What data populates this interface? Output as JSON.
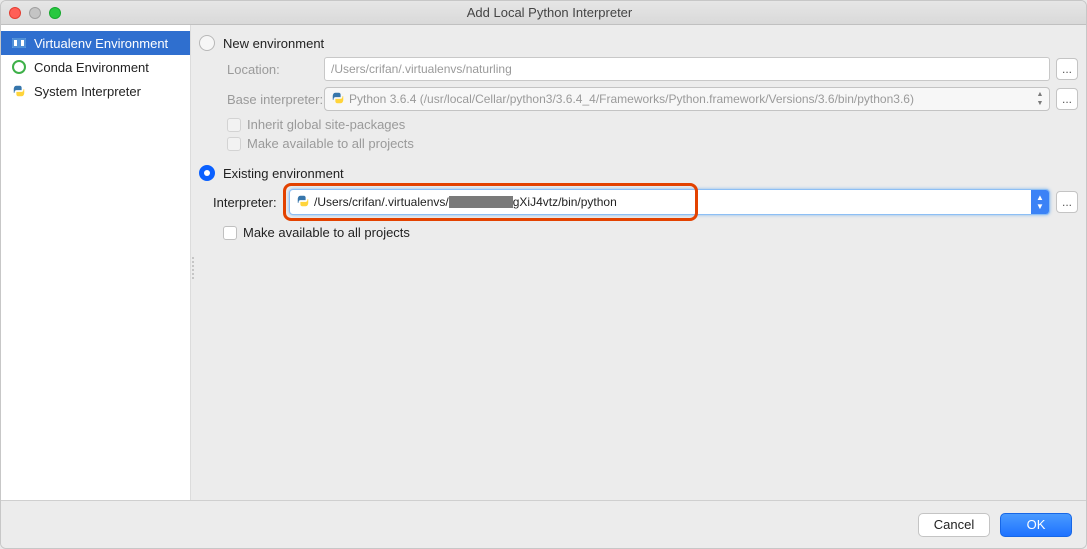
{
  "window": {
    "title": "Add Local Python Interpreter"
  },
  "sidebar": {
    "items": [
      {
        "label": "Virtualenv Environment",
        "icon": "virtualenv-icon",
        "selected": true
      },
      {
        "label": "Conda Environment",
        "icon": "conda-icon",
        "selected": false
      },
      {
        "label": "System Interpreter",
        "icon": "python-icon",
        "selected": false
      }
    ]
  },
  "new_env": {
    "radio_label": "New environment",
    "location_label": "Location:",
    "location_value": "/Users/crifan/.virtualenvs/naturling",
    "base_label": "Base interpreter:",
    "base_value": "Python 3.6.4 (/usr/local/Cellar/python3/3.6.4_4/Frameworks/Python.framework/Versions/3.6/bin/python3.6)",
    "inherit_label": "Inherit global site-packages",
    "make_available_label": "Make available to all projects"
  },
  "existing_env": {
    "radio_label": "Existing environment",
    "interpreter_label": "Interpreter:",
    "interpreter_prefix": "/Users/crifan/.virtualenvs/",
    "interpreter_suffix": "gXiJ4vtz/bin/python",
    "make_available_label": "Make available to all projects"
  },
  "buttons": {
    "cancel": "Cancel",
    "ok": "OK",
    "browse": "..."
  }
}
